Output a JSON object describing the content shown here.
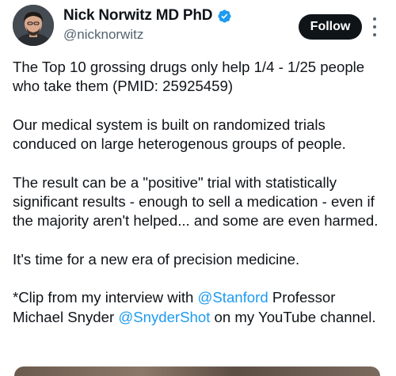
{
  "author": {
    "display_name": "Nick Norwitz MD PhD",
    "handle": "@nicknorwitz",
    "verified_icon": "verified-badge-icon",
    "verified_color": "#1d9bf0"
  },
  "actions": {
    "follow_label": "Follow",
    "more_icon": "more-options-icon"
  },
  "tweet": {
    "p1": "The Top 10 grossing drugs only help 1/4 - 1/25 people who take them (PMID: 25925459)",
    "p2": "Our medical system is built on randomized trials conduced on large heterogenous groups of people.",
    "p3": "The result can be a \"positive\" trial with statistically significant results - enough to sell a medication - even if the majority aren't helped... and some are even harmed.",
    "p4": "It's time for a new era of precision medicine.",
    "p5": {
      "t1": "*Clip from my interview with ",
      "mention1": "@Stanford",
      "t2": " Professor Michael Snyder ",
      "mention2": "@SnyderShot",
      "t3": " on my YouTube channel."
    }
  },
  "colors": {
    "text": "#0f1419",
    "secondary": "#536471",
    "link": "#1d9bf0",
    "button_bg": "#0f1419"
  }
}
